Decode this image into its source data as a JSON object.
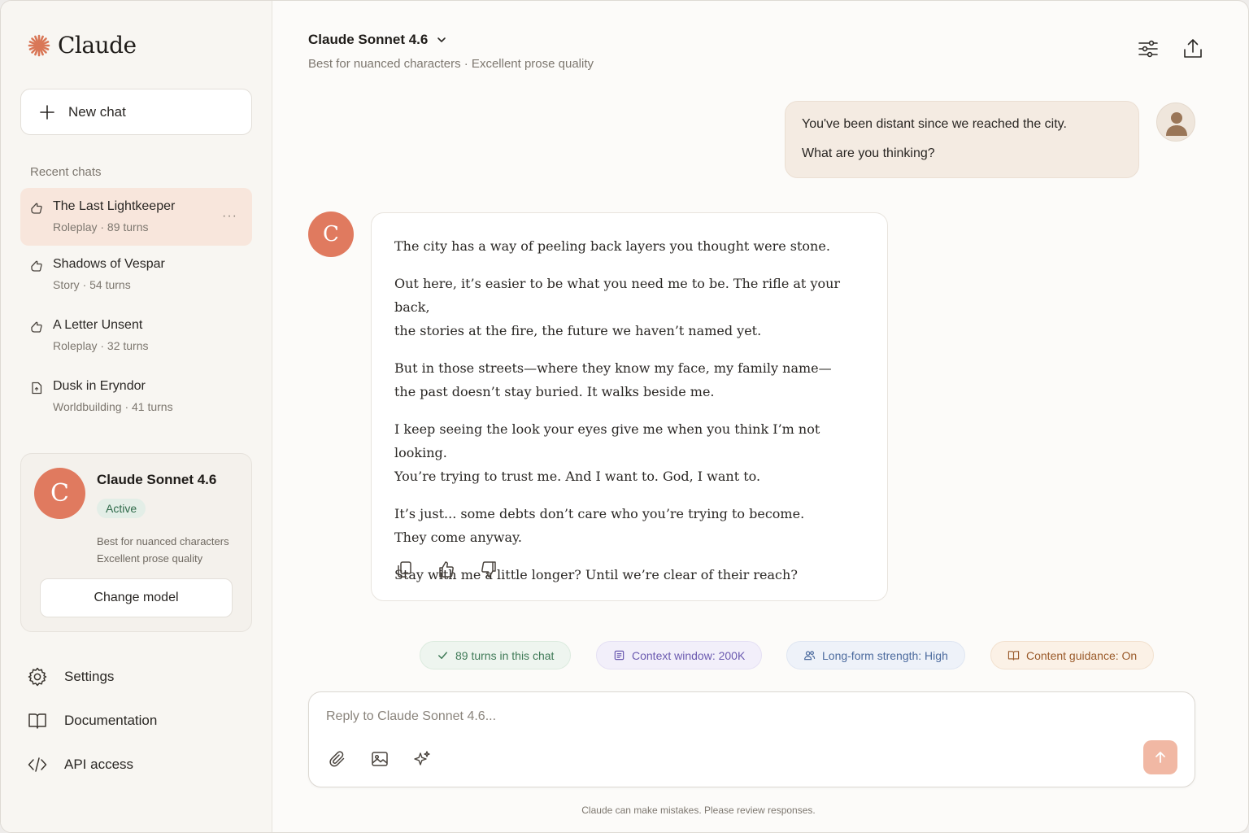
{
  "app": {
    "name": "Claude",
    "brand_color": "#e07a5f"
  },
  "sidebar": {
    "new_chat_label": "New chat",
    "recent_heading": "Recent chats",
    "chats": [
      {
        "title": "The Last Lightkeeper",
        "meta": "Roleplay · 89 turns",
        "icon": "roleplay-icon",
        "active": true,
        "more": "···"
      },
      {
        "title": "Shadows of Vespar",
        "meta": "Story · 54 turns",
        "icon": "story-icon",
        "active": false
      },
      {
        "title": "A Letter Unsent",
        "meta": "Roleplay · 32 turns",
        "icon": "roleplay-icon",
        "active": false
      },
      {
        "title": "Dusk in Eryndor",
        "meta": "Worldbuilding · 41 turns",
        "icon": "document-icon",
        "active": false
      }
    ],
    "model_card": {
      "avatar_letter": "C",
      "name": "Claude Sonnet 4.6",
      "status": "Active",
      "desc_line1": "Best for nuanced characters",
      "desc_line2": "Excellent prose quality",
      "change_label": "Change model"
    },
    "nav": [
      {
        "label": "Settings",
        "icon": "gear-icon"
      },
      {
        "label": "Documentation",
        "icon": "book-icon"
      },
      {
        "label": "API access",
        "icon": "code-icon"
      }
    ]
  },
  "header": {
    "model_name": "Claude Sonnet 4.6",
    "subtitle": "Best for nuanced characters · Excellent prose quality"
  },
  "conversation": {
    "user_message": {
      "line1": "You've been distant since we reached the city.",
      "line2": "What are you thinking?"
    },
    "assistant": {
      "avatar_letter": "C",
      "paragraphs": [
        "The city has a way of peeling back layers you thought were stone.",
        "Out here, it’s easier to be what you need me to be. The rifle at your back,\nthe stories at the fire, the future we haven’t named yet.",
        "But in those streets—where they know my face, my family name—\nthe past doesn’t stay buried. It walks beside me.",
        "I keep seeing the look your eyes give me when you think I’m not looking.\nYou’re trying to trust me. And I want to. God, I want to.",
        "It’s just... some debts don’t care who you’re trying to become.\nThey come anyway.",
        "Stay with me a little longer? Until we’re clear of their reach?"
      ]
    }
  },
  "chips": [
    {
      "label": "89 turns in this chat",
      "icon": "check-icon",
      "color": "#3f7a57",
      "bg": "#eef5ef",
      "border": "#dcebdf"
    },
    {
      "label": "Context window: 200K",
      "icon": "window-icon",
      "color": "#6b5ab0",
      "bg": "#f2effa",
      "border": "#e5e0f4"
    },
    {
      "label": "Long-form strength: High",
      "icon": "users-icon",
      "color": "#4c6b9e",
      "bg": "#eef2f9",
      "border": "#dfe6f2"
    },
    {
      "label": "Content guidance: On",
      "icon": "book-open-icon",
      "color": "#9a5a2a",
      "bg": "#fbf1e6",
      "border": "#f2e1cf"
    }
  ],
  "composer": {
    "placeholder": "Reply to Claude Sonnet 4.6..."
  },
  "footer_note": "Claude can make mistakes. Please review responses."
}
